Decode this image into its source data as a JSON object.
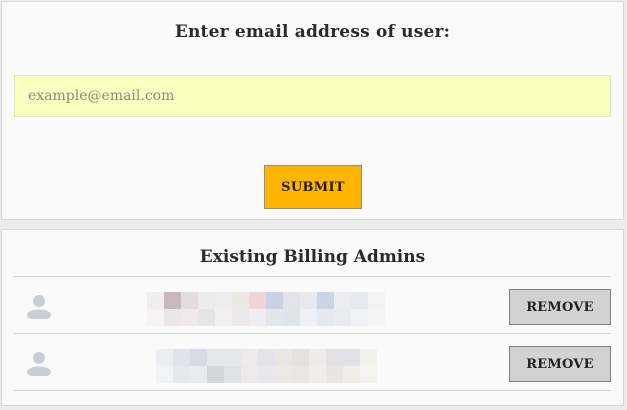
{
  "form": {
    "prompt": "Enter email address of user:",
    "email_placeholder": "example@email.com",
    "email_value": "",
    "submit_label": "SUBMIT",
    "input_bg_color": "#f9ffbd",
    "submit_color": "#ffb500"
  },
  "admins": {
    "title": "Existing Billing Admins",
    "rows": [
      {
        "email_hidden": true,
        "remove_label": "REMOVE",
        "avatar_icon": "user-icon"
      },
      {
        "email_hidden": true,
        "remove_label": "REMOVE",
        "avatar_icon": "user-icon"
      }
    ]
  }
}
